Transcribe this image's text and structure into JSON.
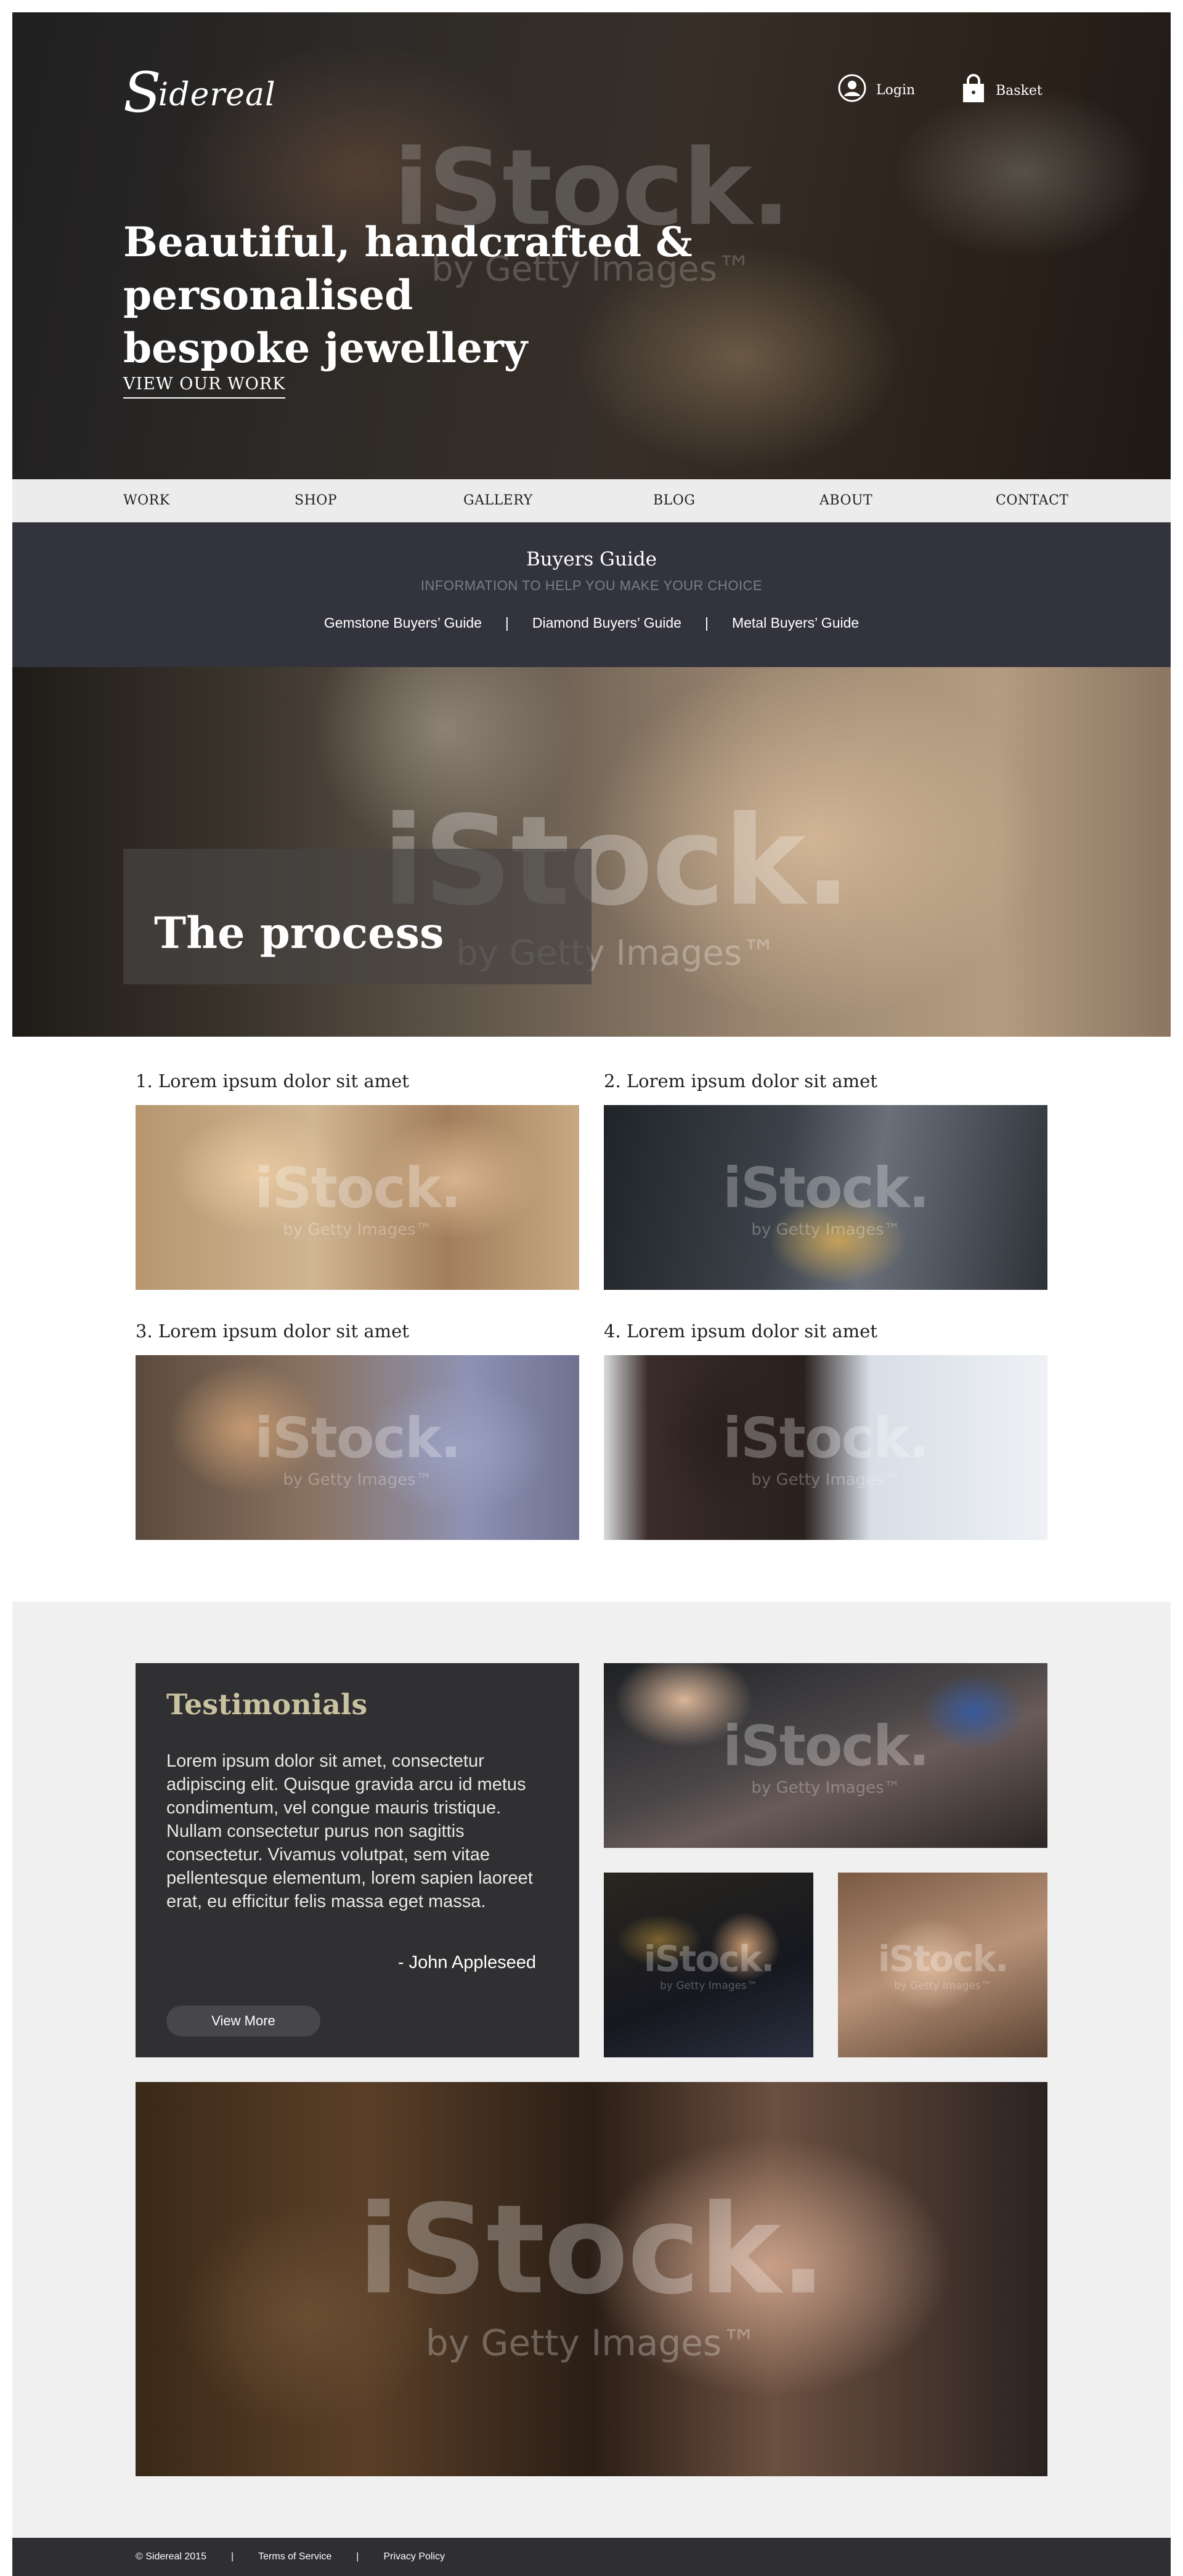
{
  "brand": {
    "logo_text": "Sidereal",
    "logo_initial": "S",
    "logo_rest": "idereal"
  },
  "header": {
    "login_label": "Login",
    "basket_label": "Basket"
  },
  "hero": {
    "title_line1": "Beautiful, handcrafted & personalised",
    "title_line2": "bespoke jewellery",
    "cta_label": "VIEW OUR WORK"
  },
  "main_nav": {
    "items": [
      {
        "label": "WORK"
      },
      {
        "label": "SHOP"
      },
      {
        "label": "GALLERY"
      },
      {
        "label": "BLOG"
      },
      {
        "label": "ABOUT"
      },
      {
        "label": "CONTACT"
      }
    ]
  },
  "buyers_guide": {
    "title": "Buyers Guide",
    "subtitle": "INFORMATION TO HELP YOU MAKE YOUR CHOICE",
    "links": [
      {
        "label": "Gemstone Buyers’ Guide"
      },
      {
        "label": "Diamond Buyers’ Guide"
      },
      {
        "label": "Metal Buyers’ Guide"
      }
    ],
    "separator": "|"
  },
  "process": {
    "title": "The process",
    "steps": [
      {
        "label": "1. Lorem ipsum dolor sit amet"
      },
      {
        "label": "2. Lorem ipsum dolor sit amet"
      },
      {
        "label": "3. Lorem ipsum dolor sit amet"
      },
      {
        "label": "4. Lorem ipsum dolor sit amet"
      }
    ]
  },
  "testimonials": {
    "title": "Testimonials",
    "text": "Lorem ipsum dolor sit amet, consectetur adipiscing elit. Quisque gravida arcu id metus condimentum, vel congue mauris tristique. Nullam consectetur purus non sagittis consectetur. Vivamus volutpat, sem vitae pellentesque elementum, lorem sapien laoreet erat, eu efficitur felis massa eget massa.",
    "author": "- John Appleseed",
    "button_label": "View More"
  },
  "watermark": {
    "brand": "iStock.",
    "sub": "by Getty Images™"
  },
  "footer": {
    "copyright": "© Sidereal 2015",
    "separator": "|",
    "terms_label": "Terms of Service",
    "privacy_label": "Privacy Policy"
  },
  "colors": {
    "nav_bg": "#ececec",
    "guide_bg": "#33333e",
    "testimonial_bg": "#302f31",
    "testimonial_title": "#c9c2a0",
    "footer_bg": "#2f2f33"
  },
  "icons": {
    "login": "user-circle-icon",
    "basket": "shopping-bag-icon"
  }
}
